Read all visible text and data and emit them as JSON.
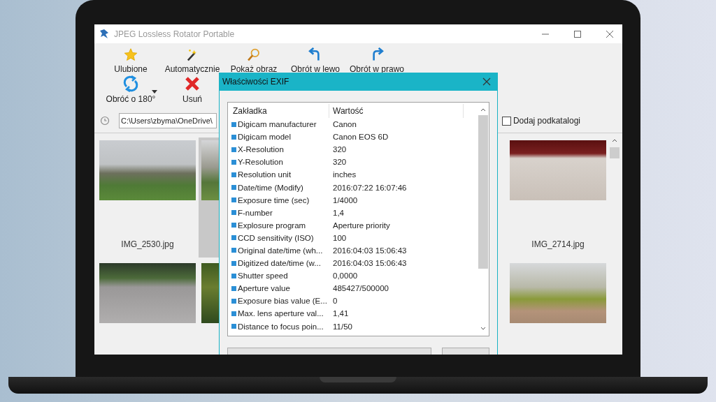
{
  "window": {
    "title": "JPEG Lossless Rotator Portable"
  },
  "toolbar": {
    "rows": [
      [
        {
          "label": "Ulubione",
          "kind": "star"
        },
        {
          "label": "Automatycznie",
          "kind": "wand"
        },
        {
          "label": "Pokaż obraz",
          "kind": "magnifier"
        },
        {
          "label": "Obrót w lewo",
          "kind": "rotateleft"
        },
        {
          "label": "Obrót w prawo",
          "kind": "rotateright"
        }
      ],
      [
        {
          "label": "Obróć o 180°",
          "kind": "rotatedropdown"
        },
        {
          "label": "Usuń",
          "kind": "delete"
        }
      ]
    ]
  },
  "path_bar": {
    "path": "C:\\Users\\zbyma\\OneDrive\\",
    "add_subfolders": {
      "label": "Dodaj podkatalogi",
      "checked": false
    }
  },
  "thumbnails": {
    "left": [
      {
        "label": "IMG_2530.jpg",
        "selected": false,
        "kind": "playground"
      },
      {
        "selected": true,
        "kind": "building"
      },
      {
        "selected": false,
        "kind": "plaza"
      },
      {
        "selected": false,
        "kind": "garden"
      }
    ],
    "right": [
      {
        "label": "IMG_2714.jpg",
        "selected": false,
        "kind": "bath"
      },
      {
        "selected": false,
        "kind": "path"
      }
    ]
  },
  "dialog": {
    "title": "Właściwości EXIF",
    "columns": [
      "Zakładka",
      "Wartość"
    ],
    "rows": [
      {
        "tag": "Digicam manufacturer",
        "value": "Canon"
      },
      {
        "tag": "Digicam model",
        "value": "Canon EOS 6D"
      },
      {
        "tag": "X-Resolution",
        "value": "320"
      },
      {
        "tag": "Y-Resolution",
        "value": "320"
      },
      {
        "tag": "Resolution unit",
        "value": "inches"
      },
      {
        "tag": "Date/time (Modify)",
        "value": "2016:07:22 16:07:46"
      },
      {
        "tag": "Exposure time (sec)",
        "value": "1/4000"
      },
      {
        "tag": "F-number",
        "value": "1,4"
      },
      {
        "tag": "Explosure program",
        "value": "Aperture priority"
      },
      {
        "tag": "CCD sensitivity (ISO)",
        "value": "100"
      },
      {
        "tag": "Original date/time (wh...",
        "value": "2016:04:03 15:06:43"
      },
      {
        "tag": "Digitized date/time (w...",
        "value": "2016:04:03 15:06:43"
      },
      {
        "tag": "Shutter speed",
        "value": "0,0000"
      },
      {
        "tag": "Aperture value",
        "value": "485427/500000"
      },
      {
        "tag": "Exposure bias value (E...",
        "value": "0"
      },
      {
        "tag": "Max. lens aperture val...",
        "value": "1,41"
      },
      {
        "tag": "Distance to focus poin...",
        "value": "11/50"
      }
    ],
    "buttons": [
      {
        "kind": "wide"
      },
      {
        "kind": "narrow"
      }
    ]
  }
}
